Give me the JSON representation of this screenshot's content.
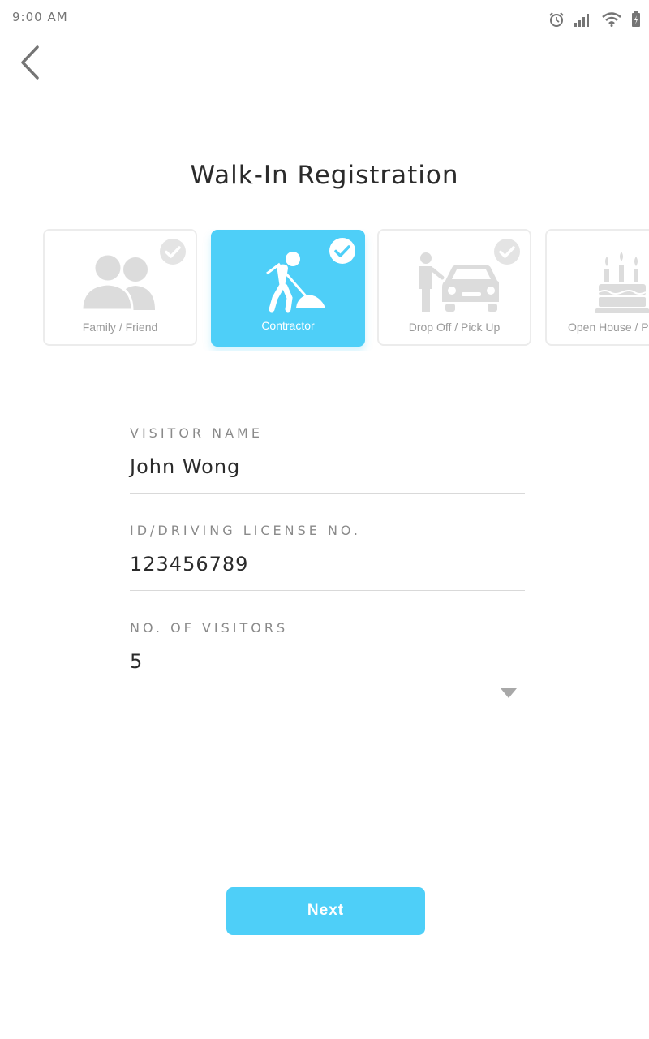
{
  "status_bar": {
    "time": "9:00 AM",
    "icons": [
      "alarm-icon",
      "signal-icon",
      "wifi-icon",
      "battery-icon"
    ]
  },
  "header": {
    "back_icon": "chevron-left-icon",
    "title": "Walk-In Registration"
  },
  "categories": [
    {
      "label": "Family / Friend",
      "icon": "people-icon",
      "selected": false
    },
    {
      "label": "Contractor",
      "icon": "worker-icon",
      "selected": true
    },
    {
      "label": "Drop Off / Pick Up",
      "icon": "car-icon",
      "selected": false
    },
    {
      "label": "Open House / Pa",
      "icon": "cake-icon",
      "selected": false
    }
  ],
  "form": {
    "visitor_name": {
      "label": "VISITOR NAME",
      "value": "John Wong"
    },
    "id_license": {
      "label": "ID/DRIVING LICENSE NO.",
      "value": "123456789"
    },
    "visitors": {
      "label": "NO. OF VISITORS",
      "value": "5"
    }
  },
  "actions": {
    "next_label": "Next"
  },
  "colors": {
    "accent": "#4ecff8",
    "inactive_icon": "#dcdcdc",
    "text": "#2b2b2b",
    "label": "#8a8a8a"
  }
}
